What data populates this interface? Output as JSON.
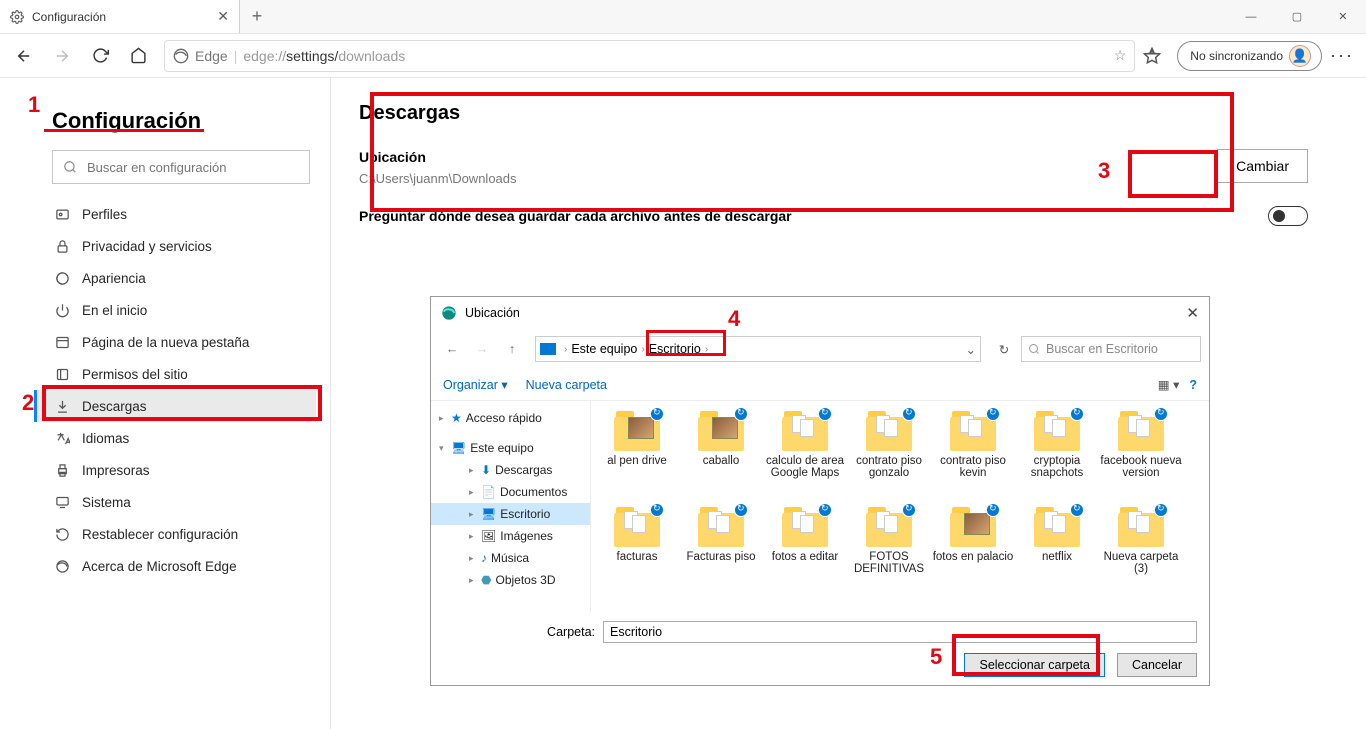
{
  "titlebar": {
    "tab_title": "Configuración"
  },
  "toolbar": {
    "url_label": "Edge",
    "url_prefix": "edge://",
    "url_mid": "settings/",
    "url_end": "downloads",
    "sync_label": "No sincronizando"
  },
  "sidebar": {
    "title": "Configuración",
    "search_placeholder": "Buscar en configuración",
    "items": [
      {
        "label": "Perfiles"
      },
      {
        "label": "Privacidad y servicios"
      },
      {
        "label": "Apariencia"
      },
      {
        "label": "En el inicio"
      },
      {
        "label": "Página de la nueva pestaña"
      },
      {
        "label": "Permisos del sitio"
      },
      {
        "label": "Descargas"
      },
      {
        "label": "Idiomas"
      },
      {
        "label": "Impresoras"
      },
      {
        "label": "Sistema"
      },
      {
        "label": "Restablecer configuración"
      },
      {
        "label": "Acerca de Microsoft Edge"
      }
    ]
  },
  "main": {
    "title": "Descargas",
    "location_label": "Ubicación",
    "location_path": "C:\\Users\\juanm\\Downloads",
    "change_label": "Cambiar",
    "ask_label": "Preguntar dónde desea guardar cada archivo antes de descargar"
  },
  "dialog": {
    "title": "Ubicación",
    "crumb1": "Este equipo",
    "crumb2": "Escritorio",
    "search_placeholder": "Buscar en Escritorio",
    "organize": "Organizar",
    "newfolder": "Nueva carpeta",
    "tree": {
      "quick": "Acceso rápido",
      "thispc": "Este equipo",
      "downloads": "Descargas",
      "documents": "Documentos",
      "desktop": "Escritorio",
      "images": "Imágenes",
      "music": "Música",
      "objects3d": "Objetos 3D"
    },
    "files": [
      {
        "name": "al pen drive",
        "style": "img"
      },
      {
        "name": "caballo",
        "style": "img"
      },
      {
        "name": "calculo de area Google Maps",
        "style": "docfolder"
      },
      {
        "name": "contrato piso gonzalo",
        "style": "docfolder"
      },
      {
        "name": "contrato piso kevin",
        "style": "docfolder"
      },
      {
        "name": "cryptopia snapchots",
        "style": "docfolder"
      },
      {
        "name": "facebook nueva version",
        "style": "docfolder"
      },
      {
        "name": "facturas",
        "style": "docfolder"
      },
      {
        "name": "Facturas piso",
        "style": "docfolder"
      },
      {
        "name": "fotos a editar",
        "style": "docfolder"
      },
      {
        "name": "FOTOS DEFINITIVAS",
        "style": "docfolder"
      },
      {
        "name": "fotos en palacio",
        "style": "img"
      },
      {
        "name": "netflix",
        "style": "docfolder"
      },
      {
        "name": "Nueva carpeta (3)",
        "style": "docfolder"
      }
    ],
    "folder_label": "Carpeta:",
    "folder_value": "Escritorio",
    "select_btn": "Seleccionar carpeta",
    "cancel_btn": "Cancelar"
  },
  "callouts": {
    "n1": "1",
    "n2": "2",
    "n3": "3",
    "n4": "4",
    "n5": "5"
  }
}
